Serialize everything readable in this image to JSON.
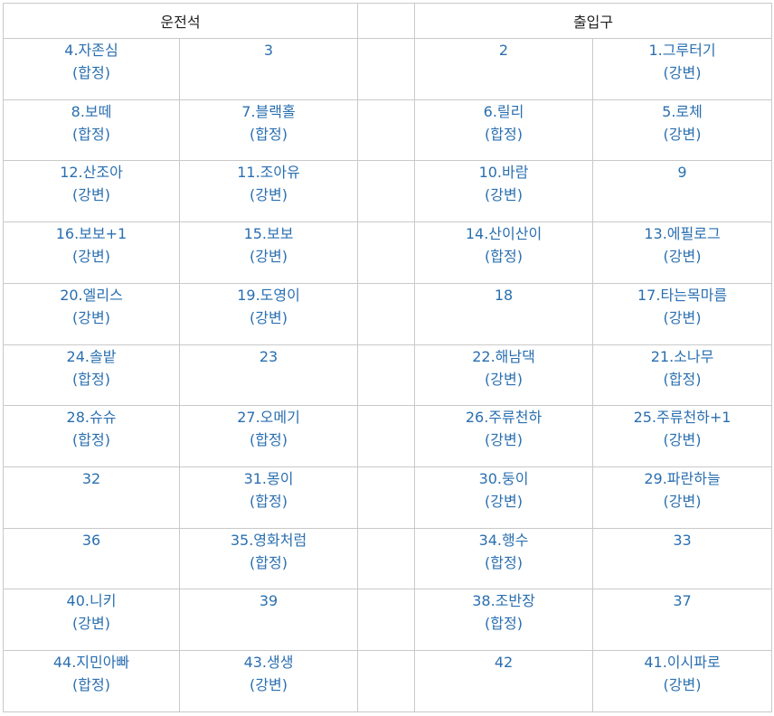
{
  "headers": {
    "left": "운전석",
    "right": "출입구"
  },
  "rows": [
    [
      {
        "name": "4.자존심",
        "note": "(합정)"
      },
      {
        "name": "3",
        "note": ""
      },
      {
        "name": "2",
        "note": ""
      },
      {
        "name": "1.그루터기",
        "note": "(강변)"
      }
    ],
    [
      {
        "name": "8.보떼",
        "note": "(합정)"
      },
      {
        "name": "7.블랙홀",
        "note": "(합정)"
      },
      {
        "name": "6.릴리",
        "note": "(합정)"
      },
      {
        "name": "5.로체",
        "note": "(강변)"
      }
    ],
    [
      {
        "name": "12.산조아",
        "note": "(강변)"
      },
      {
        "name": "11.조아유",
        "note": "(강변)"
      },
      {
        "name": "10.바람",
        "note": "(강변)"
      },
      {
        "name": "9",
        "note": ""
      }
    ],
    [
      {
        "name": "16.보보+1",
        "note": "(강변)"
      },
      {
        "name": "15.보보",
        "note": "(강변)"
      },
      {
        "name": "14.산이산이",
        "note": "(합정)"
      },
      {
        "name": "13.에필로그",
        "note": "(강변)"
      }
    ],
    [
      {
        "name": "20.엘리스",
        "note": "(강변)"
      },
      {
        "name": "19.도영이",
        "note": "(강변)"
      },
      {
        "name": "18",
        "note": ""
      },
      {
        "name": "17.타는목마름",
        "note": "(강변)"
      }
    ],
    [
      {
        "name": "24.솔밭",
        "note": "(합정)"
      },
      {
        "name": "23",
        "note": ""
      },
      {
        "name": "22.해남댁",
        "note": "(강변)"
      },
      {
        "name": "21.소나무",
        "note": "(합정)"
      }
    ],
    [
      {
        "name": "28.슈슈",
        "note": "(합정)"
      },
      {
        "name": "27.오메기",
        "note": "(합정)"
      },
      {
        "name": "26.주류천하",
        "note": "(강변)"
      },
      {
        "name": "25.주류천하+1",
        "note": "(강변)"
      }
    ],
    [
      {
        "name": "32",
        "note": ""
      },
      {
        "name": "31.몽이",
        "note": "(합정)"
      },
      {
        "name": "30.둥이",
        "note": "(강변)"
      },
      {
        "name": "29.파란하늘",
        "note": "(강변)"
      }
    ],
    [
      {
        "name": "36",
        "note": ""
      },
      {
        "name": "35.영화처럼",
        "note": "(합정)"
      },
      {
        "name": "34.행수",
        "note": "(합정)"
      },
      {
        "name": "33",
        "note": ""
      }
    ],
    [
      {
        "name": "40.니키",
        "note": "(강변)"
      },
      {
        "name": "39",
        "note": ""
      },
      {
        "name": "38.조반장",
        "note": "(합정)"
      },
      {
        "name": "37",
        "note": ""
      }
    ],
    [
      {
        "name": "44.지민아빠",
        "note": "(합정)"
      },
      {
        "name": "43.생생",
        "note": "(강변)"
      },
      {
        "name": "42",
        "note": ""
      },
      {
        "name": "41.이시파로",
        "note": "(강변)"
      }
    ]
  ],
  "colors": {
    "seat_text": "#2a6fb0",
    "header_text": "#222222",
    "border": "#c9c9c9"
  }
}
